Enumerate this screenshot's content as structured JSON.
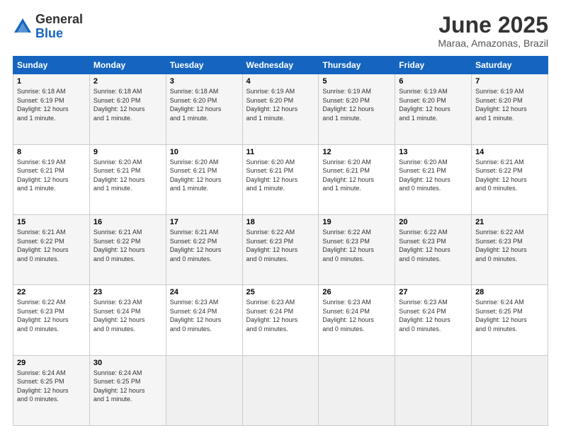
{
  "header": {
    "logo_general": "General",
    "logo_blue": "Blue",
    "title": "June 2025",
    "subtitle": "Maraa, Amazonas, Brazil"
  },
  "days_of_week": [
    "Sunday",
    "Monday",
    "Tuesday",
    "Wednesday",
    "Thursday",
    "Friday",
    "Saturday"
  ],
  "weeks": [
    [
      {
        "day": "1",
        "info": "Sunrise: 6:18 AM\nSunset: 6:19 PM\nDaylight: 12 hours\nand 1 minute."
      },
      {
        "day": "2",
        "info": "Sunrise: 6:18 AM\nSunset: 6:20 PM\nDaylight: 12 hours\nand 1 minute."
      },
      {
        "day": "3",
        "info": "Sunrise: 6:18 AM\nSunset: 6:20 PM\nDaylight: 12 hours\nand 1 minute."
      },
      {
        "day": "4",
        "info": "Sunrise: 6:19 AM\nSunset: 6:20 PM\nDaylight: 12 hours\nand 1 minute."
      },
      {
        "day": "5",
        "info": "Sunrise: 6:19 AM\nSunset: 6:20 PM\nDaylight: 12 hours\nand 1 minute."
      },
      {
        "day": "6",
        "info": "Sunrise: 6:19 AM\nSunset: 6:20 PM\nDaylight: 12 hours\nand 1 minute."
      },
      {
        "day": "7",
        "info": "Sunrise: 6:19 AM\nSunset: 6:20 PM\nDaylight: 12 hours\nand 1 minute."
      }
    ],
    [
      {
        "day": "8",
        "info": "Sunrise: 6:19 AM\nSunset: 6:21 PM\nDaylight: 12 hours\nand 1 minute."
      },
      {
        "day": "9",
        "info": "Sunrise: 6:20 AM\nSunset: 6:21 PM\nDaylight: 12 hours\nand 1 minute."
      },
      {
        "day": "10",
        "info": "Sunrise: 6:20 AM\nSunset: 6:21 PM\nDaylight: 12 hours\nand 1 minute."
      },
      {
        "day": "11",
        "info": "Sunrise: 6:20 AM\nSunset: 6:21 PM\nDaylight: 12 hours\nand 1 minute."
      },
      {
        "day": "12",
        "info": "Sunrise: 6:20 AM\nSunset: 6:21 PM\nDaylight: 12 hours\nand 1 minute."
      },
      {
        "day": "13",
        "info": "Sunrise: 6:20 AM\nSunset: 6:21 PM\nDaylight: 12 hours\nand 0 minutes."
      },
      {
        "day": "14",
        "info": "Sunrise: 6:21 AM\nSunset: 6:22 PM\nDaylight: 12 hours\nand 0 minutes."
      }
    ],
    [
      {
        "day": "15",
        "info": "Sunrise: 6:21 AM\nSunset: 6:22 PM\nDaylight: 12 hours\nand 0 minutes."
      },
      {
        "day": "16",
        "info": "Sunrise: 6:21 AM\nSunset: 6:22 PM\nDaylight: 12 hours\nand 0 minutes."
      },
      {
        "day": "17",
        "info": "Sunrise: 6:21 AM\nSunset: 6:22 PM\nDaylight: 12 hours\nand 0 minutes."
      },
      {
        "day": "18",
        "info": "Sunrise: 6:22 AM\nSunset: 6:23 PM\nDaylight: 12 hours\nand 0 minutes."
      },
      {
        "day": "19",
        "info": "Sunrise: 6:22 AM\nSunset: 6:23 PM\nDaylight: 12 hours\nand 0 minutes."
      },
      {
        "day": "20",
        "info": "Sunrise: 6:22 AM\nSunset: 6:23 PM\nDaylight: 12 hours\nand 0 minutes."
      },
      {
        "day": "21",
        "info": "Sunrise: 6:22 AM\nSunset: 6:23 PM\nDaylight: 12 hours\nand 0 minutes."
      }
    ],
    [
      {
        "day": "22",
        "info": "Sunrise: 6:22 AM\nSunset: 6:23 PM\nDaylight: 12 hours\nand 0 minutes."
      },
      {
        "day": "23",
        "info": "Sunrise: 6:23 AM\nSunset: 6:24 PM\nDaylight: 12 hours\nand 0 minutes."
      },
      {
        "day": "24",
        "info": "Sunrise: 6:23 AM\nSunset: 6:24 PM\nDaylight: 12 hours\nand 0 minutes."
      },
      {
        "day": "25",
        "info": "Sunrise: 6:23 AM\nSunset: 6:24 PM\nDaylight: 12 hours\nand 0 minutes."
      },
      {
        "day": "26",
        "info": "Sunrise: 6:23 AM\nSunset: 6:24 PM\nDaylight: 12 hours\nand 0 minutes."
      },
      {
        "day": "27",
        "info": "Sunrise: 6:23 AM\nSunset: 6:24 PM\nDaylight: 12 hours\nand 0 minutes."
      },
      {
        "day": "28",
        "info": "Sunrise: 6:24 AM\nSunset: 6:25 PM\nDaylight: 12 hours\nand 0 minutes."
      }
    ],
    [
      {
        "day": "29",
        "info": "Sunrise: 6:24 AM\nSunset: 6:25 PM\nDaylight: 12 hours\nand 0 minutes."
      },
      {
        "day": "30",
        "info": "Sunrise: 6:24 AM\nSunset: 6:25 PM\nDaylight: 12 hours\nand 1 minute."
      },
      {
        "day": "",
        "info": ""
      },
      {
        "day": "",
        "info": ""
      },
      {
        "day": "",
        "info": ""
      },
      {
        "day": "",
        "info": ""
      },
      {
        "day": "",
        "info": ""
      }
    ]
  ]
}
